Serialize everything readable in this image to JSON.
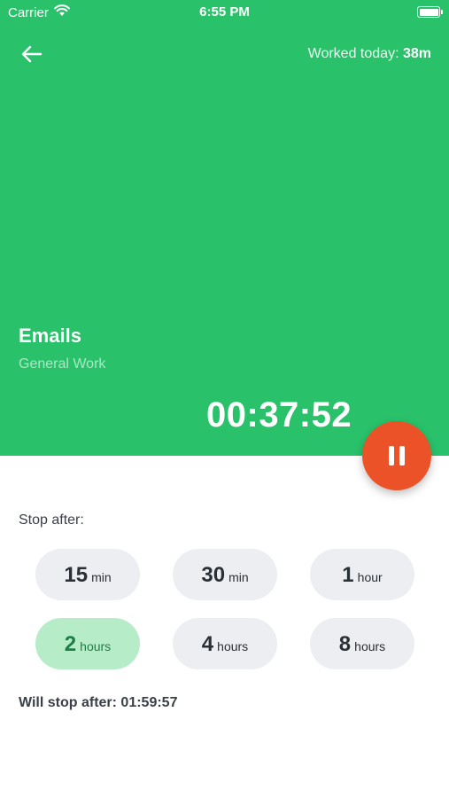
{
  "status_bar": {
    "carrier": "Carrier",
    "time": "6:55 PM"
  },
  "header": {
    "worked_today_label": "Worked today:",
    "worked_today_value": "38m"
  },
  "task": {
    "title": "Emails",
    "category": "General Work",
    "elapsed": "00:37:52"
  },
  "stop_after": {
    "label": "Stop after:",
    "options": [
      {
        "num": "15",
        "unit": "min",
        "selected": false
      },
      {
        "num": "30",
        "unit": "min",
        "selected": false
      },
      {
        "num": "1",
        "unit": "hour",
        "selected": false
      },
      {
        "num": "2",
        "unit": "hours",
        "selected": true
      },
      {
        "num": "4",
        "unit": "hours",
        "selected": false
      },
      {
        "num": "8",
        "unit": "hours",
        "selected": false
      }
    ],
    "will_stop_text": "Will stop after: 01:59:57"
  },
  "colors": {
    "hero": "#29c26b",
    "pause": "#eb5228",
    "chip": "#eceef2",
    "chip_selected": "#b7ecc9"
  }
}
